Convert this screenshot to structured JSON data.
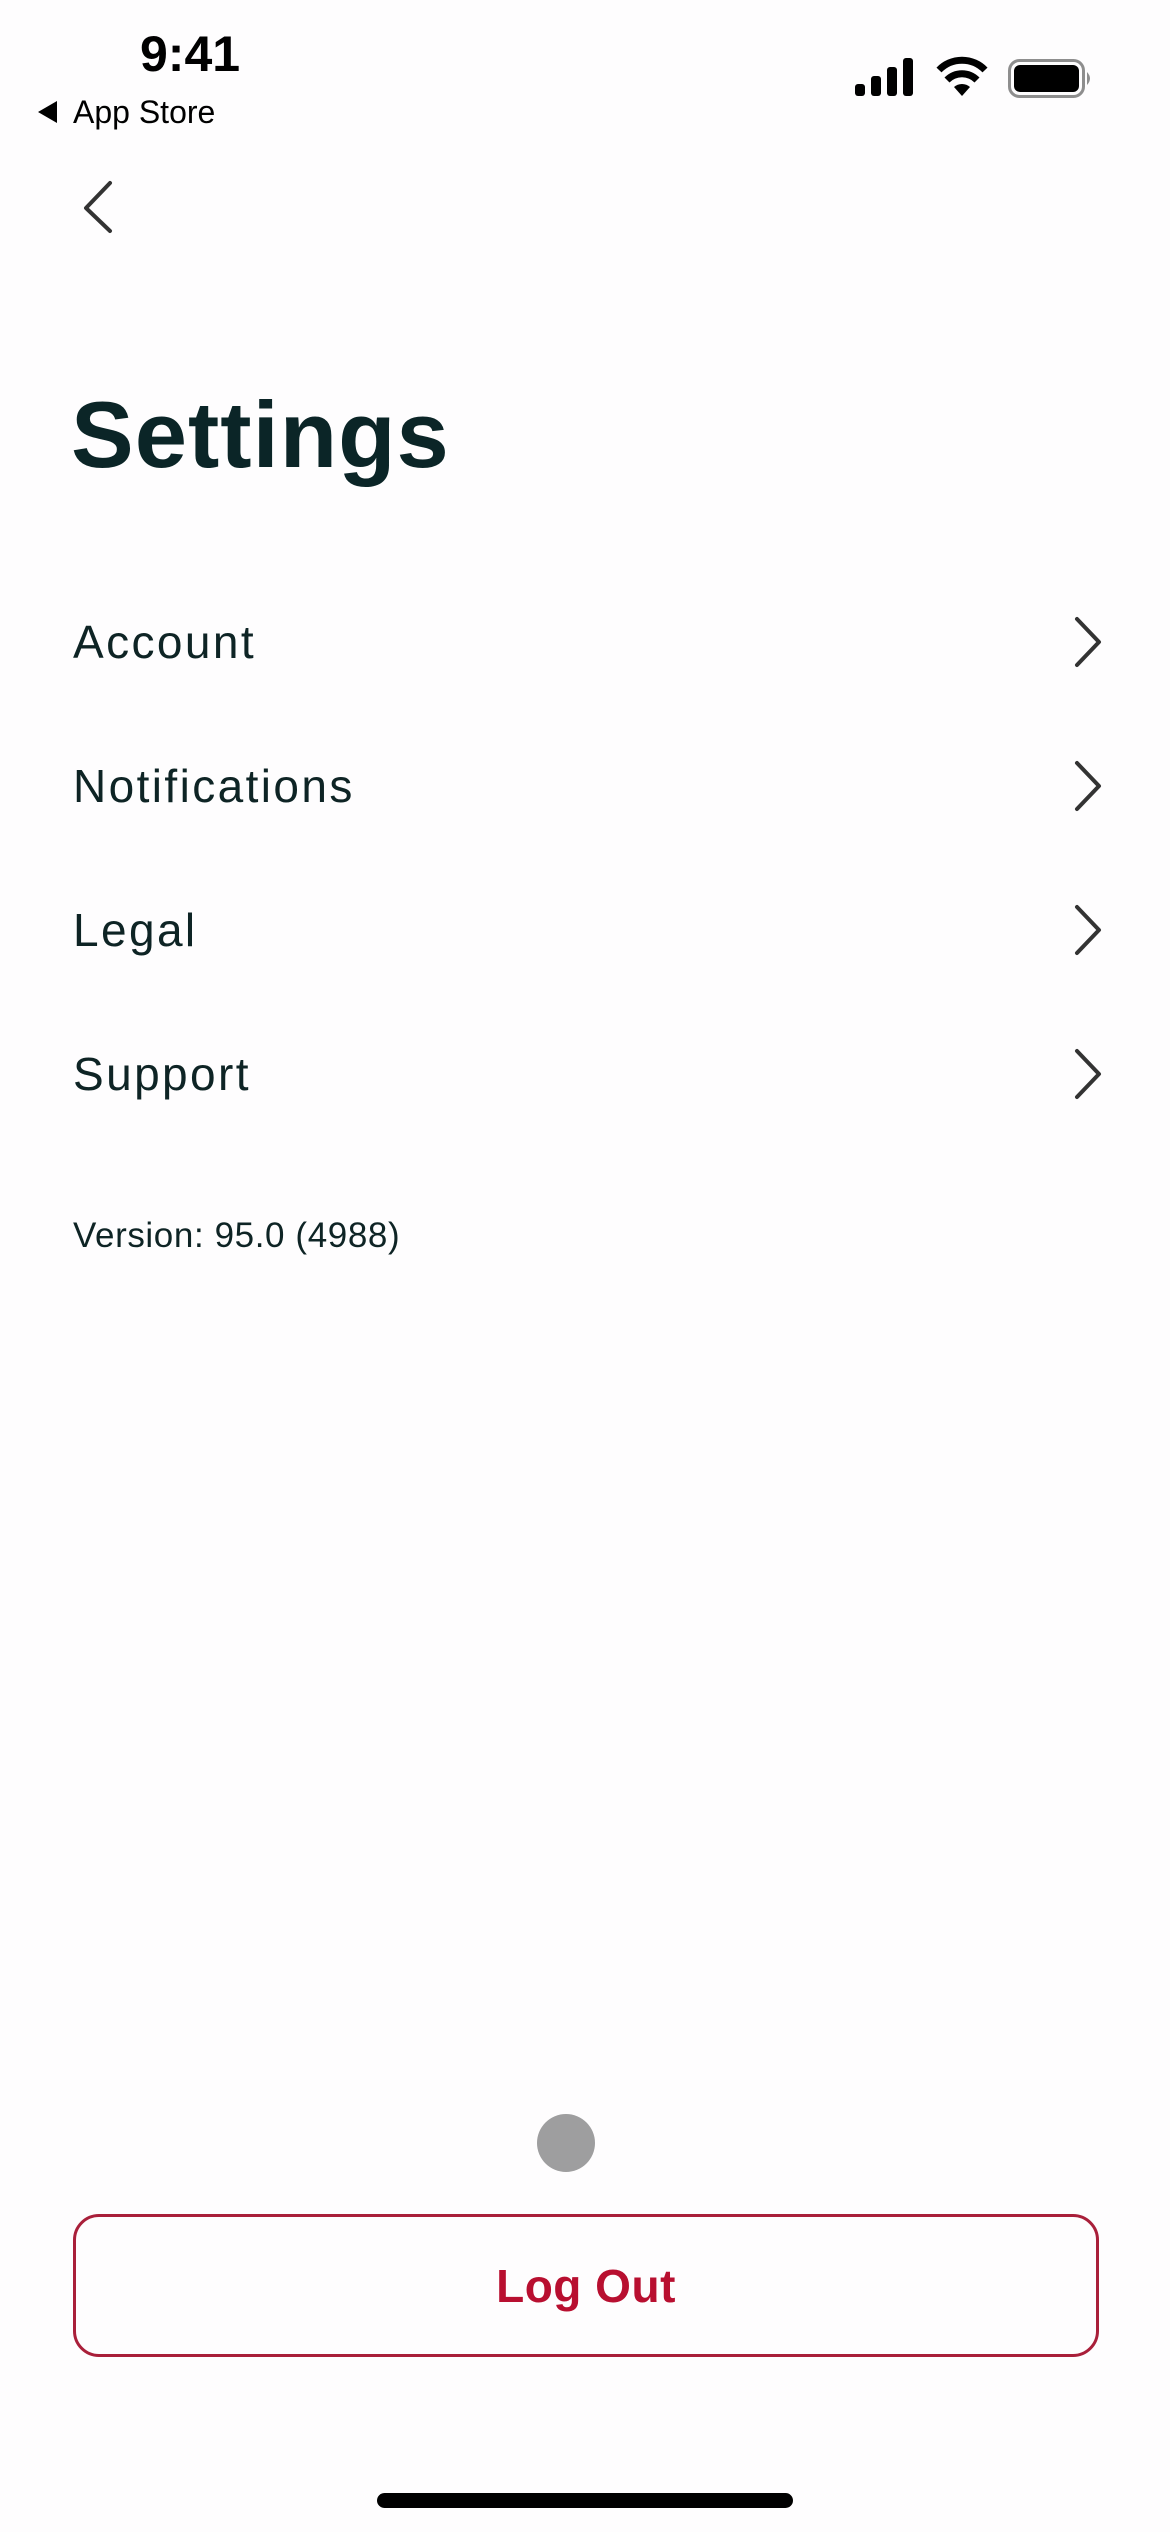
{
  "status_bar": {
    "time": "9:41",
    "back_app_label": "App Store",
    "back_app_icon": "triangle-left-icon",
    "icons": [
      "cellular-signal-icon",
      "wifi-icon",
      "battery-icon"
    ]
  },
  "nav": {
    "back_icon": "chevron-left-icon"
  },
  "page": {
    "title": "Settings"
  },
  "menu": {
    "items": [
      {
        "label": "Account",
        "icon": "chevron-right-icon"
      },
      {
        "label": "Notifications",
        "icon": "chevron-right-icon"
      },
      {
        "label": "Legal",
        "icon": "chevron-right-icon"
      },
      {
        "label": "Support",
        "icon": "chevron-right-icon"
      }
    ]
  },
  "version_text": "Version: 95.0 (4988)",
  "footer": {
    "logout_label": "Log Out"
  },
  "colors": {
    "text": "#0e2425",
    "title": "#0b2527",
    "logout_accent": "#b80f30",
    "logout_border": "#a91f3a",
    "indicator_dot": "#9e9e9f",
    "background": "#fefdfe"
  }
}
